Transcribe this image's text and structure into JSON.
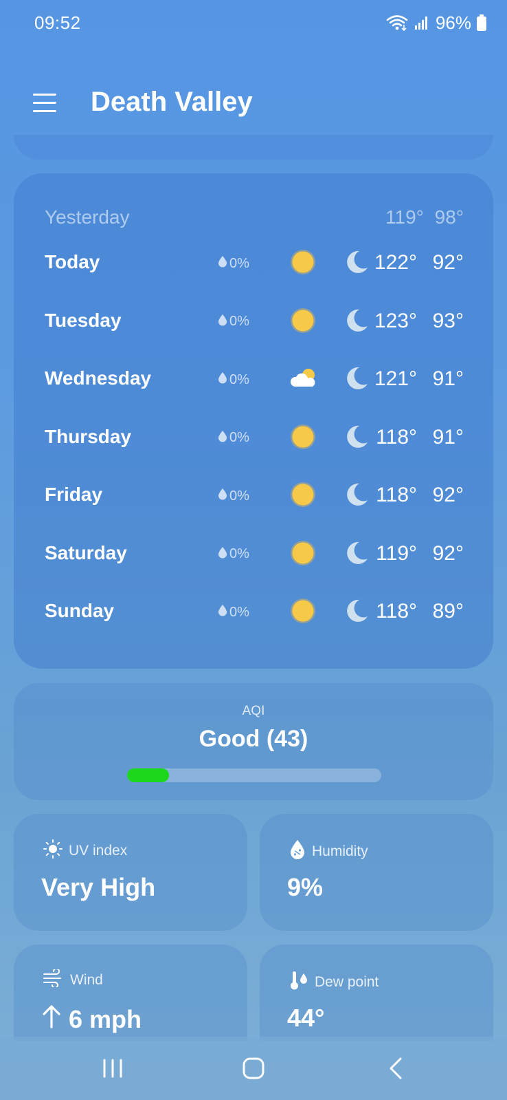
{
  "status_bar": {
    "time": "09:52",
    "battery": "96%"
  },
  "header": {
    "title": "Death Valley"
  },
  "forecast": {
    "yesterday": {
      "label": "Yesterday",
      "high": "119°",
      "low": "98°"
    },
    "days": [
      {
        "name": "Today",
        "precip": "0%",
        "day_icon": "sun-icon",
        "night_icon": "moon-icon",
        "high": "122°",
        "low": "92°"
      },
      {
        "name": "Tuesday",
        "precip": "0%",
        "day_icon": "sun-icon",
        "night_icon": "moon-icon",
        "high": "123°",
        "low": "93°"
      },
      {
        "name": "Wednesday",
        "precip": "0%",
        "day_icon": "partly-cloudy-icon",
        "night_icon": "moon-icon",
        "high": "121°",
        "low": "91°"
      },
      {
        "name": "Thursday",
        "precip": "0%",
        "day_icon": "sun-icon",
        "night_icon": "moon-icon",
        "high": "118°",
        "low": "91°"
      },
      {
        "name": "Friday",
        "precip": "0%",
        "day_icon": "sun-icon",
        "night_icon": "moon-icon",
        "high": "118°",
        "low": "92°"
      },
      {
        "name": "Saturday",
        "precip": "0%",
        "day_icon": "sun-icon",
        "night_icon": "moon-icon",
        "high": "119°",
        "low": "92°"
      },
      {
        "name": "Sunday",
        "precip": "0%",
        "day_icon": "sun-icon",
        "night_icon": "moon-icon",
        "high": "118°",
        "low": "89°"
      }
    ]
  },
  "aqi": {
    "label": "AQI",
    "value": "Good (43)",
    "bar_fraction": 0.165,
    "bar_color": "#1dd71d"
  },
  "details": {
    "uv": {
      "label": "UV index",
      "value": "Very High",
      "icon": "sun-outline-icon"
    },
    "humidity": {
      "label": "Humidity",
      "value": "9%",
      "icon": "humidity-drop-icon"
    },
    "wind": {
      "label": "Wind",
      "value": "6 mph",
      "icon": "wind-icon",
      "direction_icon": "arrow-up-icon"
    },
    "dew_point": {
      "label": "Dew point",
      "value": "44°",
      "icon": "thermometer-drop-icon"
    }
  },
  "colors": {
    "sun": "#f7c948",
    "moon": "#cfe0ef",
    "background_top": "#5595e2"
  }
}
